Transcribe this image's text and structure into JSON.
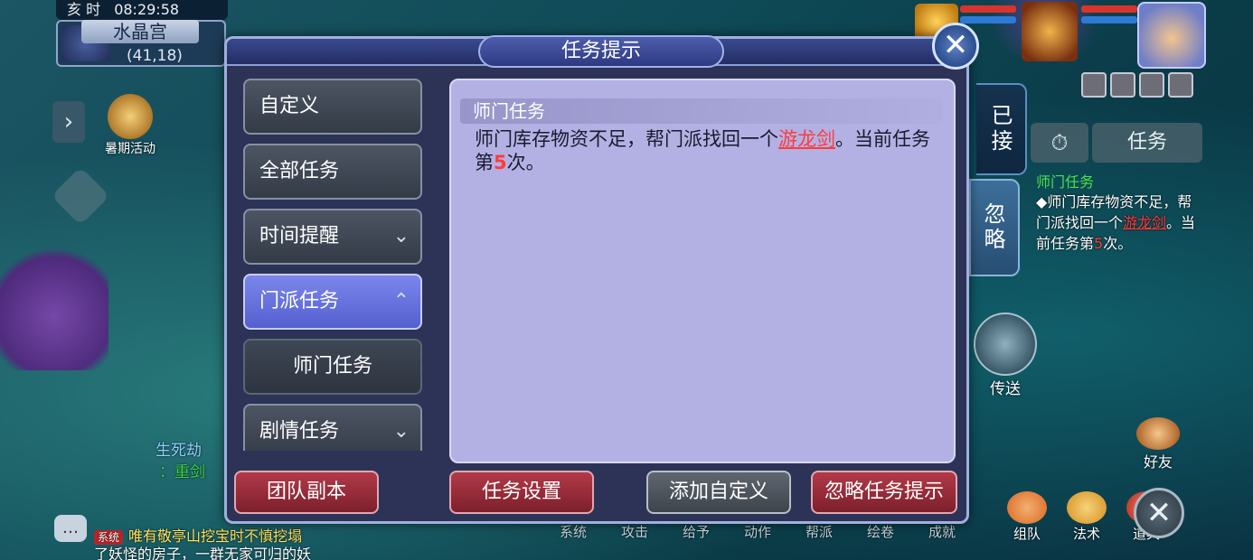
{
  "hud": {
    "period": "亥 时",
    "clock": "08:29:58",
    "map_name": "水晶宫",
    "coords": "(41,18)",
    "summer_activity": "暑期活动",
    "teleport": "传送",
    "friend": "好友"
  },
  "dialog": {
    "title": "任务提示",
    "categories": [
      {
        "label": "自定义",
        "chevron": ""
      },
      {
        "label": "全部任务",
        "chevron": ""
      },
      {
        "label": "时间提醒",
        "chevron": "⌄"
      },
      {
        "label": "门派任务",
        "chevron": "⌃"
      },
      {
        "label": "师门任务",
        "chevron": ""
      },
      {
        "label": "剧情任务",
        "chevron": "⌄"
      }
    ],
    "content": {
      "heading": "师门任务",
      "text_pre": "师门库存物资不足，帮门派找回一个",
      "item_link": "游龙剑",
      "text_mid": "。当前任务第",
      "count": "5",
      "text_post": "次。"
    },
    "buttons": {
      "team_dungeon": "团队副本",
      "task_settings": "任务设置",
      "add_custom": "添加自定义",
      "ignore_hint": "忽略任务提示"
    }
  },
  "side_tabs": {
    "accepted": "已接",
    "ignore": "忽略"
  },
  "tracker": {
    "timer_icon": "⏱",
    "task_label": "任务",
    "title": "师门任务",
    "body_pre": "◆师门库存物资不足，帮门派找回一个",
    "item": "游龙剑",
    "body_mid": "。当前任务第",
    "count": "5",
    "body_post": "次。"
  },
  "bottom_menu": [
    "系统",
    "攻击",
    "给予",
    "动作",
    "帮派",
    "绘卷",
    "成就"
  ],
  "bottom_icons": [
    {
      "label": "组队",
      "color": "#e27c3a"
    },
    {
      "label": "法术",
      "color": "#e0a23a"
    },
    {
      "label": "道具",
      "color": "#c8412e"
    }
  ],
  "chat": {
    "sys_tag": "系统",
    "line1": "唯有敬亭山挖宝时不慎挖塌",
    "line2": "了妖怪的房子，一群无家可归的妖",
    "side1": "生死劫",
    "side2": "：重剑"
  },
  "colors": {
    "accent": "#5560d0",
    "link_red": "#ff3b3b",
    "panel": "#b3b1e4"
  }
}
